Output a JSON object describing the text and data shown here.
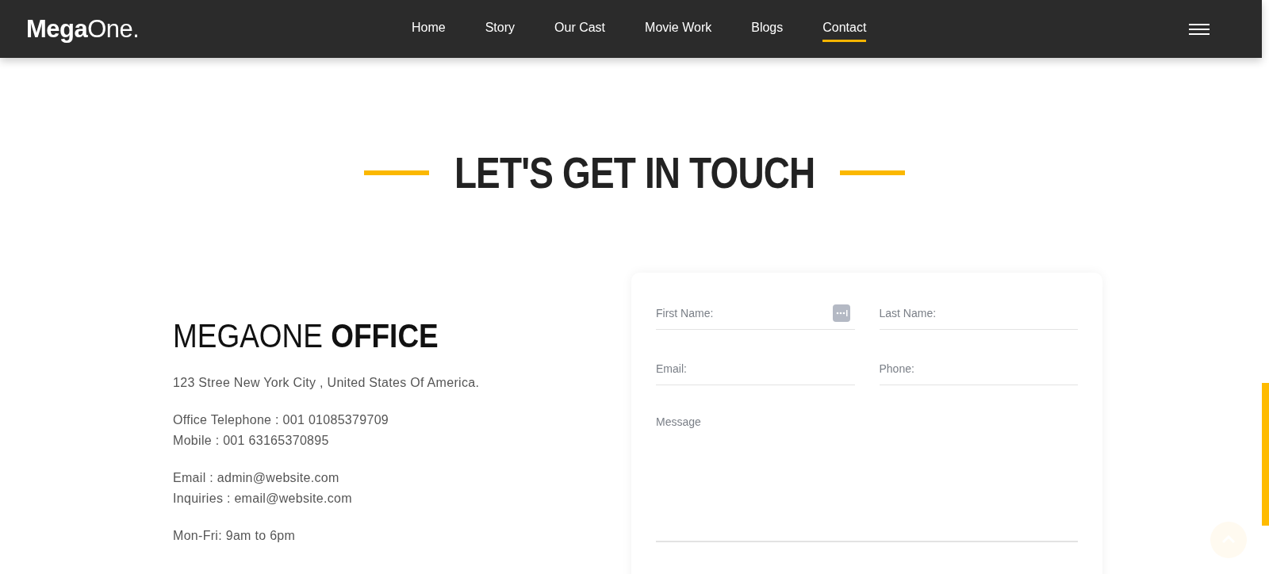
{
  "header": {
    "logo": {
      "bold": "Mega",
      "light": "One."
    },
    "nav": [
      {
        "label": "Home",
        "selected": false
      },
      {
        "label": "Story",
        "selected": false
      },
      {
        "label": "Our Cast",
        "selected": false
      },
      {
        "label": "Movie Work",
        "selected": false
      },
      {
        "label": "Blogs",
        "selected": false
      },
      {
        "label": "Contact",
        "selected": true
      }
    ]
  },
  "section_title": "LET'S GET IN TOUCH",
  "office": {
    "title_light": "MEGAONE",
    "title_bold": "OFFICE",
    "lines": [
      [
        "123 Stree New York City , United States Of America."
      ],
      [
        "Office Telephone : 001 01085379709",
        "Mobile : 001 63165370895"
      ],
      [
        "Email : admin@website.com",
        "Inquiries : email@website.com"
      ],
      [
        "Mon-Fri: 9am to 6pm"
      ]
    ]
  },
  "form": {
    "fields": [
      {
        "placeholder": "First Name:",
        "kind": "text",
        "autofill": true
      },
      {
        "placeholder": "Last Name:",
        "kind": "text",
        "autofill": false
      },
      {
        "placeholder": "Email:",
        "kind": "text",
        "autofill": false
      },
      {
        "placeholder": "Phone:",
        "kind": "text",
        "autofill": false
      },
      {
        "placeholder": "Message",
        "kind": "textarea",
        "autofill": false
      }
    ]
  }
}
